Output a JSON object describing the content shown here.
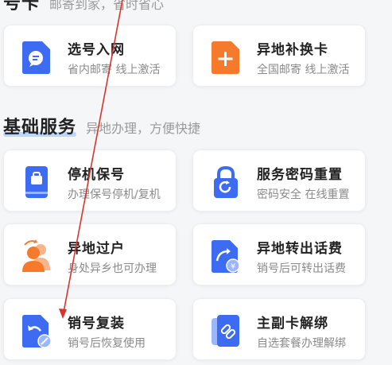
{
  "top_section": {
    "title": "号卡",
    "subtitle": "邮寄到家，省时省心"
  },
  "top_cards": [
    {
      "name": "选号入网",
      "desc": "省内邮寄 线上激活",
      "icon": "sim-card-chat-icon",
      "color": "#3d6cf2"
    },
    {
      "name": "异地补换卡",
      "desc": "全国邮寄 线上激活",
      "icon": "sim-card-plus-icon",
      "color": "#f57a2b"
    }
  ],
  "basic_section": {
    "title": "基础服务",
    "subtitle": "异地办理，方便快捷"
  },
  "basic_cards": [
    {
      "name": "停机保号",
      "desc": "办理保号停机/复机",
      "icon": "phone-pause-icon",
      "color": "#3d6cf2"
    },
    {
      "name": "服务密码重置",
      "desc": "密码安全 在线重置",
      "icon": "lock-reset-icon",
      "color": "#3d6cf2"
    },
    {
      "name": "异地过户",
      "desc": "身处异乡也可办理",
      "icon": "user-transfer-icon",
      "color": "#f57a2b"
    },
    {
      "name": "异地转出话费",
      "desc": "销号后可转出话费",
      "icon": "yuan-transfer-icon",
      "color": "#3d6cf2"
    },
    {
      "name": "销号复装",
      "desc": "销号后恢复使用",
      "icon": "sim-restore-icon",
      "color": "#3d6cf2"
    },
    {
      "name": "主副卡解绑",
      "desc": "自选套餐办理解绑",
      "icon": "unlink-icon",
      "color": "#3d6cf2"
    }
  ],
  "annotation_color": "#d9342b"
}
